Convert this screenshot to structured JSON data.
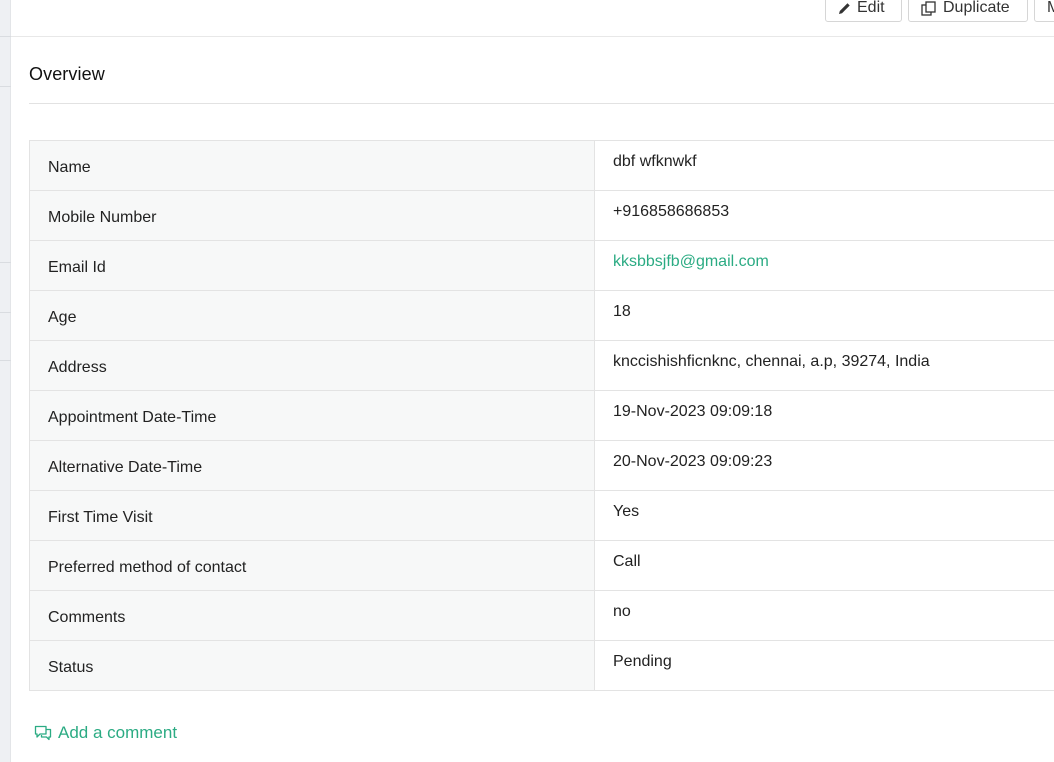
{
  "toolbar": {
    "edit_label": "Edit",
    "duplicate_label": "Duplicate",
    "more_label": "M"
  },
  "section": {
    "title": "Overview"
  },
  "details": [
    {
      "label": "Name",
      "value": "dbf wfknwkf"
    },
    {
      "label": "Mobile Number",
      "value": "+916858686853"
    },
    {
      "label": "Email Id",
      "value": "kksbbsjfb@gmail.com"
    },
    {
      "label": "Age",
      "value": "18"
    },
    {
      "label": "Address",
      "value": "knccishishficnknc, chennai, a.p, 39274, India"
    },
    {
      "label": "Appointment Date-Time",
      "value": "19-Nov-2023 09:09:18"
    },
    {
      "label": "Alternative Date-Time",
      "value": "20-Nov-2023 09:09:23"
    },
    {
      "label": "First Time Visit",
      "value": "Yes"
    },
    {
      "label": "Preferred method of contact",
      "value": "Call"
    },
    {
      "label": "Comments",
      "value": "no"
    },
    {
      "label": "Status",
      "value": "Pending"
    }
  ],
  "comment": {
    "add_label": "Add a comment"
  },
  "colors": {
    "link": "#2bab83",
    "label_bg": "#f7f8f8",
    "border": "#e3e3e3"
  },
  "icons": {
    "edit": "pencil-icon",
    "duplicate": "duplicate-icon",
    "comment": "comment-icon"
  }
}
